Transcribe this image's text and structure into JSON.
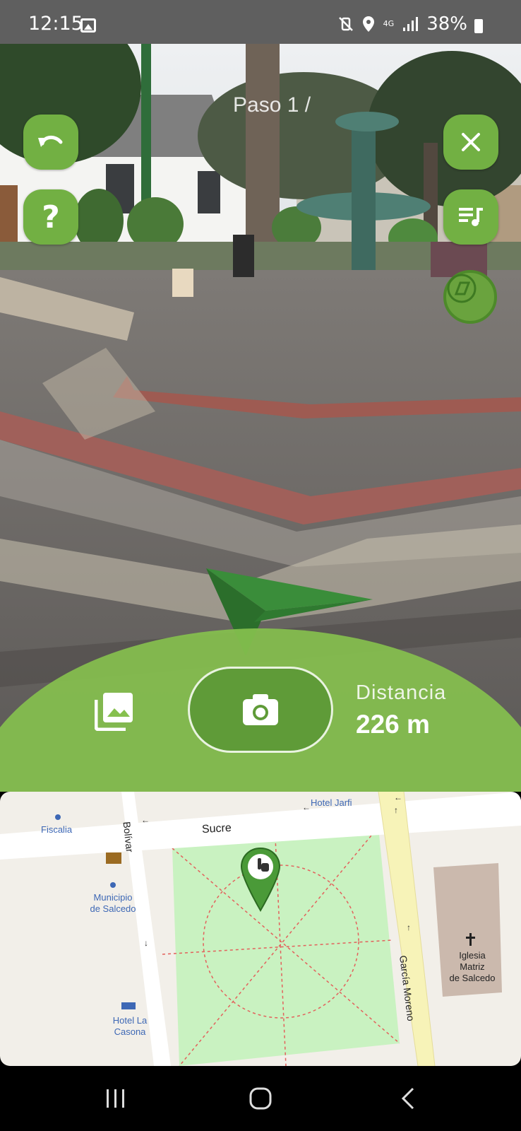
{
  "status_bar": {
    "time": "12:15",
    "network": "4G",
    "battery": "38%"
  },
  "ar_view": {
    "step_label": "Paso 1 /",
    "back_button_icon": "undo-icon",
    "help_button_label": "?",
    "close_button_icon": "close-icon",
    "playlist_button_icon": "playlist-music-icon",
    "compass_icon": "compass-plane-icon",
    "direction_arrow_icon": "navigation-arrow-icon"
  },
  "capture_panel": {
    "gallery_icon": "photo-library-icon",
    "camera_icon": "camera-icon",
    "distance_label": "Distancia",
    "distance_value": "226 m",
    "accent": "#72b043"
  },
  "map": {
    "labels": {
      "hotel_jarfi": "Hotel Jarfi",
      "fiscalia": "Fiscalia",
      "municipio_line1": "Municipio",
      "municipio_line2": "de Salcedo",
      "hotel_la_casona_line1": "Hotel La",
      "hotel_la_casona_line2": "Casona",
      "iglesia_line1": "Iglesia",
      "iglesia_line2": "Matriz",
      "iglesia_line3": "de Salcedo"
    },
    "roads": {
      "sucre": "Sucre",
      "bolivar": "Bolívar",
      "garcia_moreno": "García Moreno"
    },
    "marker_icon": "hand-pointer-pin-icon",
    "park_color": "#c9f2c1"
  },
  "nav_bar": {
    "recents_icon": "recents-icon",
    "home_icon": "home-icon",
    "back_icon": "back-icon"
  }
}
